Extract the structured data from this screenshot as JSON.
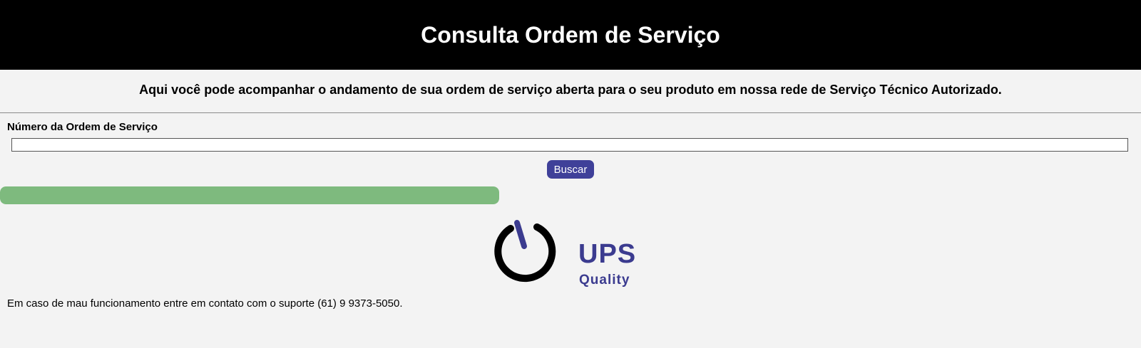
{
  "header": {
    "title": "Consulta Ordem de Serviço"
  },
  "intro": {
    "text": "Aqui você pode acompanhar o andamento de sua ordem de serviço aberta para o seu produto em nossa rede de Serviço Técnico Autorizado."
  },
  "form": {
    "label": "Número da Ordem de Serviço",
    "input_value": "",
    "search_label": "Buscar"
  },
  "progress": {
    "percent": 100,
    "color": "#7eba7e"
  },
  "logo": {
    "main_text": "UPS",
    "sub_text": "Quality",
    "brand_color": "#3b3b8f",
    "icon": "power-icon"
  },
  "footer": {
    "support_text": "Em caso de mau funcionamento entre em contato com o suporte (61) 9 9373-5050."
  },
  "colors": {
    "header_bg": "#000000",
    "page_bg": "#f3f3f3",
    "button_bg": "#3f4099"
  }
}
